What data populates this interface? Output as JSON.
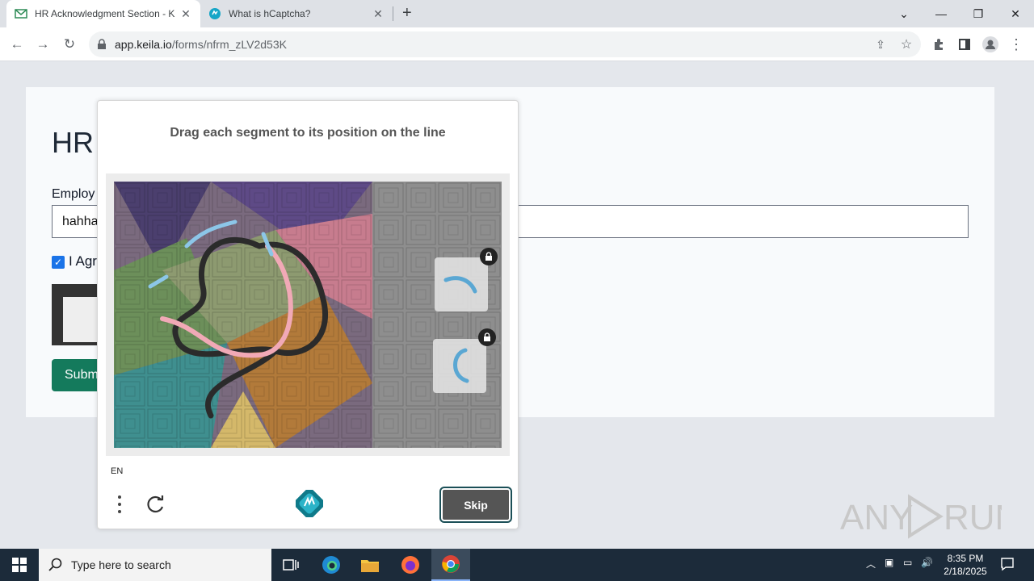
{
  "browser": {
    "tabs": [
      {
        "title": "HR Acknowledgment Section - K",
        "active": true
      },
      {
        "title": "What is hCaptcha?",
        "active": false
      }
    ],
    "url_host": "app.keila.io",
    "url_path": "/forms/nfrm_zLV2d53K"
  },
  "form": {
    "heading": "HR",
    "employee_label": "Employ",
    "employee_value": "hahha",
    "agree_label": "I Agr",
    "agree_checked": true,
    "submit_label": "Subm"
  },
  "captcha": {
    "prompt": "Drag each segment to its position on the line",
    "language": "EN",
    "skip_label": "Skip",
    "accent_color": "#1b4f57"
  },
  "watermark": {
    "text": "ANY RUN"
  },
  "taskbar": {
    "search_placeholder": "Type here to search",
    "time": "8:35 PM",
    "date": "2/18/2025"
  }
}
